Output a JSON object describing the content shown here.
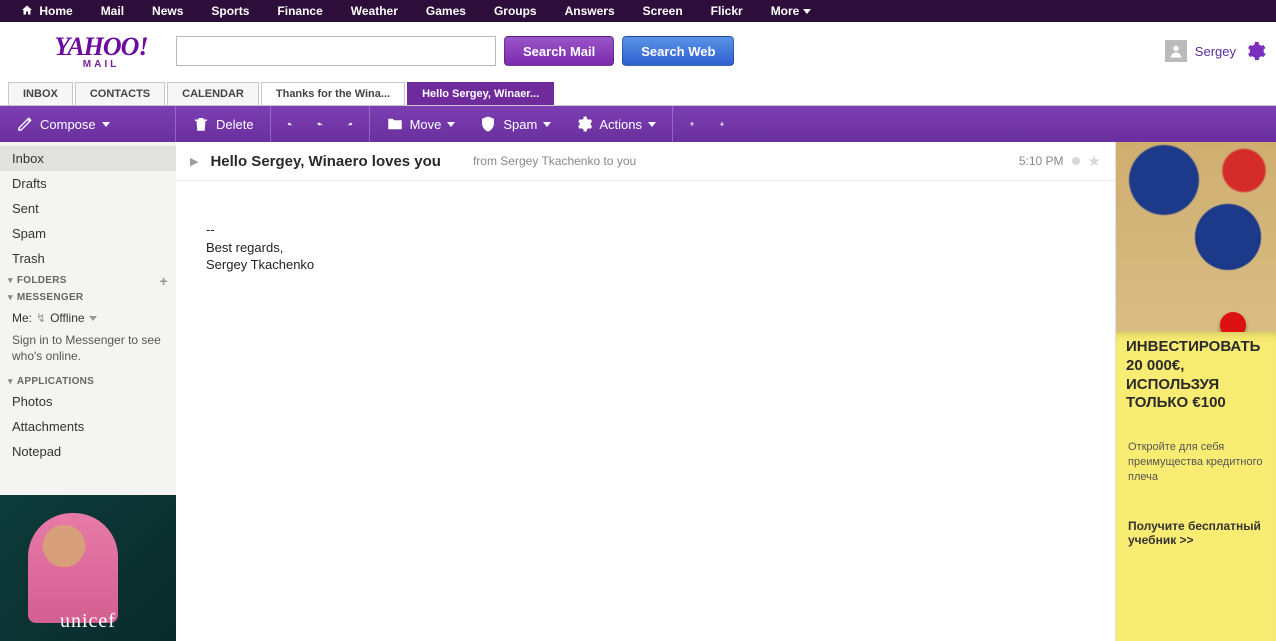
{
  "topnav": {
    "items": [
      "Home",
      "Mail",
      "News",
      "Sports",
      "Finance",
      "Weather",
      "Games",
      "Groups",
      "Answers",
      "Screen",
      "Flickr"
    ],
    "more": "More"
  },
  "logo": {
    "brand": "YAHOO!",
    "product": "MAIL"
  },
  "search": {
    "value": "",
    "mail_btn": "Search Mail",
    "web_btn": "Search Web"
  },
  "user": {
    "name": "Sergey"
  },
  "tabs": {
    "inbox": "INBOX",
    "contacts": "CONTACTS",
    "calendar": "CALENDAR",
    "doc1": "Thanks for the Wina...",
    "active": "Hello Sergey, Winaer..."
  },
  "toolbar": {
    "compose": "Compose",
    "delete": "Delete",
    "move": "Move",
    "spam": "Spam",
    "actions": "Actions"
  },
  "sidebar": {
    "folders": [
      "Inbox",
      "Drafts",
      "Sent",
      "Spam",
      "Trash"
    ],
    "folders_head": "FOLDERS",
    "messenger_head": "MESSENGER",
    "me_label": "Me:",
    "me_status": "Offline",
    "signin_note": "Sign in to Messenger to see who's online.",
    "apps_head": "APPLICATIONS",
    "apps": [
      "Photos",
      "Attachments",
      "Notepad"
    ],
    "ad_brand": "unicef"
  },
  "message": {
    "subject": "Hello Sergey, Winaero loves you",
    "from": "from Sergey Tkachenko to you",
    "time": "5:10 PM",
    "body_sep": "--",
    "body_line1": "Best regards,",
    "body_line2": "Sergey Tkachenko"
  },
  "right_ad": {
    "headline": "ИНВЕСТИРОВАТЬ 20 000€, ИСПОЛЬЗУЯ ТОЛЬКО €100",
    "sub": "Откройте для себя преимущества кредитного плеча",
    "cta": "Получите бесплатный учебник >>"
  }
}
